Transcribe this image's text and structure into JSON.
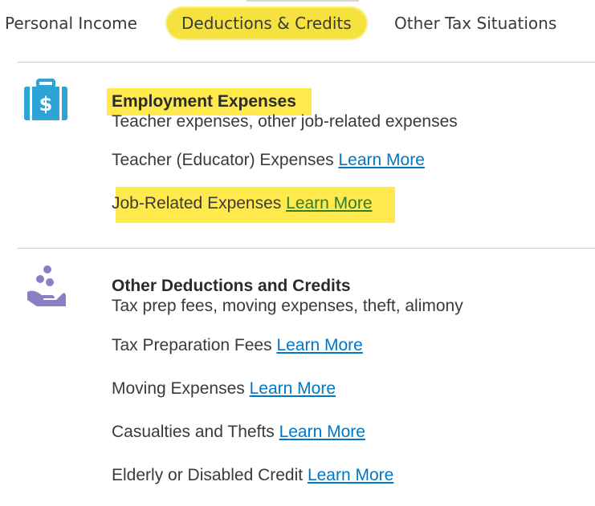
{
  "tabs": [
    {
      "label": "Personal Income"
    },
    {
      "label": "Deductions & Credits",
      "active": true
    },
    {
      "label": "Other Tax Situations"
    }
  ],
  "sections": [
    {
      "icon": "briefcase-dollar-icon",
      "title": "Employment Expenses",
      "subtitle": "Teacher expenses, other job-related expenses",
      "items": [
        {
          "label": "Teacher (Educator) Expenses",
          "link": "Learn More"
        },
        {
          "label": "Job-Related Expenses",
          "link": "Learn More"
        }
      ]
    },
    {
      "icon": "hand-coins-icon",
      "title": "Other Deductions and Credits",
      "subtitle": "Tax prep fees, moving expenses, theft, alimony",
      "items": [
        {
          "label": "Tax Preparation Fees",
          "link": "Learn More"
        },
        {
          "label": "Moving Expenses",
          "link": "Learn More"
        },
        {
          "label": "Casualties and Thefts",
          "link": "Learn More"
        },
        {
          "label": "Elderly or Disabled Credit",
          "link": "Learn More"
        }
      ]
    }
  ],
  "colors": {
    "highlight": "#ffe94d",
    "link": "#0077c5",
    "icon_blue": "#2ea3d6",
    "icon_purple": "#8a7fc4"
  }
}
